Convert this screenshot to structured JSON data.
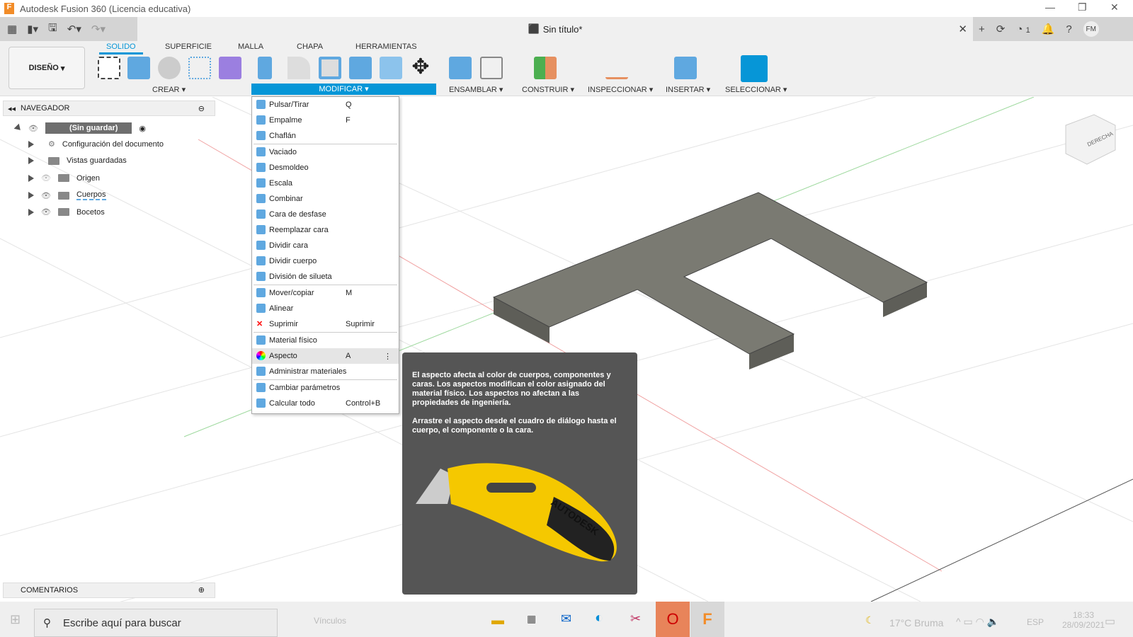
{
  "window": {
    "title": "Autodesk Fusion 360 (Licencia educativa)",
    "doc_title": "Sin título*",
    "user_initials": "FM",
    "jobs_count": "1"
  },
  "ribbon": {
    "workspace": "DISEÑO",
    "tabs": [
      "SOLIDO",
      "SUPERFICIE",
      "MALLA",
      "CHAPA",
      "HERRAMIENTAS"
    ],
    "groups": [
      "CREAR",
      "MODIFICAR",
      "ENSAMBLAR",
      "CONSTRUIR",
      "INSPECCIONAR",
      "INSERTAR",
      "SELECCIONAR"
    ]
  },
  "browser": {
    "title": "NAVEGADOR",
    "root": "(Sin guardar)",
    "items": [
      "Configuración del documento",
      "Vistas guardadas",
      "Origen",
      "Cuerpos",
      "Bocetos"
    ],
    "comments": "COMENTARIOS"
  },
  "menu": {
    "items": [
      {
        "label": "Pulsar/Tirar",
        "shortcut": "Q"
      },
      {
        "label": "Empalme",
        "shortcut": "F"
      },
      {
        "label": "Chaflán",
        "shortcut": ""
      },
      {
        "label": "Vaciado",
        "shortcut": ""
      },
      {
        "label": "Desmoldeo",
        "shortcut": ""
      },
      {
        "label": "Escala",
        "shortcut": ""
      },
      {
        "label": "Combinar",
        "shortcut": ""
      },
      {
        "label": "Cara de desfase",
        "shortcut": ""
      },
      {
        "label": "Reemplazar cara",
        "shortcut": ""
      },
      {
        "label": "Dividir cara",
        "shortcut": ""
      },
      {
        "label": "Dividir cuerpo",
        "shortcut": ""
      },
      {
        "label": "División de silueta",
        "shortcut": ""
      },
      {
        "label": "Mover/copiar",
        "shortcut": "M"
      },
      {
        "label": "Alinear",
        "shortcut": ""
      },
      {
        "label": "Suprimir",
        "shortcut": "Suprimir"
      },
      {
        "label": "Material físico",
        "shortcut": ""
      },
      {
        "label": "Aspecto",
        "shortcut": "A"
      },
      {
        "label": "Administrar materiales",
        "shortcut": ""
      },
      {
        "label": "Cambiar parámetros",
        "shortcut": ""
      },
      {
        "label": "Calcular todo",
        "shortcut": "Control+B"
      }
    ]
  },
  "tooltip": {
    "p1": "El aspecto afecta al color de cuerpos, componentes y caras. Los aspectos modifican el color asignado del material físico. Los aspectos no afectan a las propiedades de ingeniería.",
    "p2": "Arrastre el aspecto desde el cuadro de diálogo hasta el cuerpo, el componente o la cara.",
    "image_brand": "AUTODESK"
  },
  "viewcube": {
    "face": "DERECHA"
  },
  "taskbar": {
    "search_placeholder": "Escribe aquí para buscar",
    "links": "Vínculos",
    "weather": "17°C  Bruma",
    "lang": "ESP",
    "time": "18:33",
    "date": "28/09/2021"
  },
  "colors": {
    "accent": "#0696d7",
    "body": "#7a7a72"
  }
}
